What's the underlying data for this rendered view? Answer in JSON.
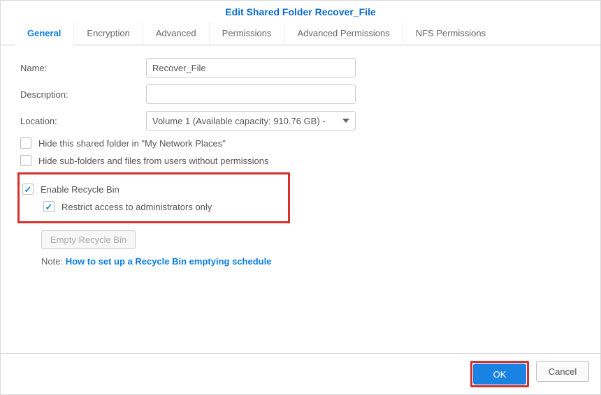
{
  "title": "Edit Shared Folder Recover_File",
  "tabs": {
    "general": "General",
    "encryption": "Encryption",
    "advanced": "Advanced",
    "permissions": "Permissions",
    "adv_permissions": "Advanced Permissions",
    "nfs": "NFS Permissions"
  },
  "labels": {
    "name": "Name:",
    "description": "Description:",
    "location": "Location:"
  },
  "values": {
    "name": "Recover_File",
    "description": "",
    "location": "Volume 1 (Available capacity: 910.76 GB) -"
  },
  "checks": {
    "hide_network": "Hide this shared folder in \"My Network Places\"",
    "hide_subfolders": "Hide sub-folders and files from users without permissions",
    "enable_recycle": "Enable Recycle Bin",
    "restrict_admin": "Restrict access to administrators only"
  },
  "buttons": {
    "empty_recycle": "Empty Recycle Bin",
    "ok": "OK",
    "cancel": "Cancel"
  },
  "note": {
    "prefix": "Note: ",
    "link": "How to set up a Recycle Bin emptying schedule"
  }
}
